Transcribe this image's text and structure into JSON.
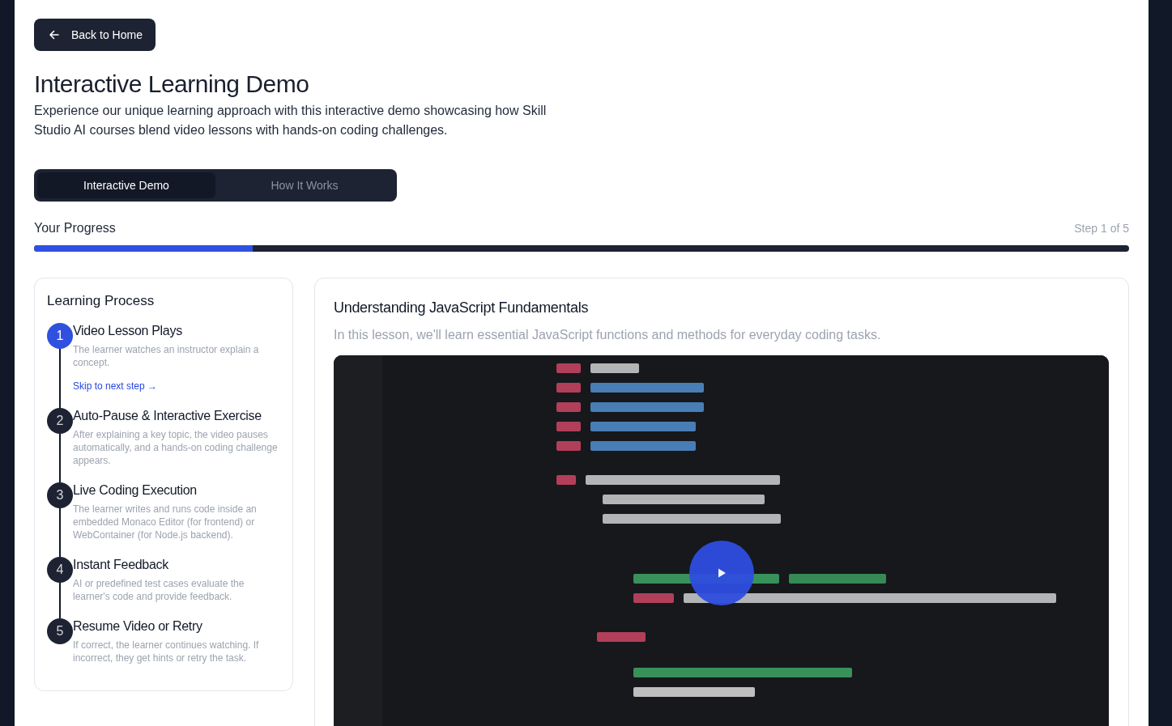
{
  "back_button": {
    "label": "Back to Home"
  },
  "title": "Interactive Learning Demo",
  "intro": "Experience our unique learning approach with this interactive demo showcasing how Skill Studio AI courses blend video lessons with hands-on coding challenges.",
  "tabs": [
    {
      "label": "Interactive Demo",
      "selected": true
    },
    {
      "label": "How It Works",
      "selected": false
    }
  ],
  "progress": {
    "label": "Your Progress",
    "step": "Step 1 of 5",
    "level": 0.2
  },
  "process": {
    "title": "Learning Process",
    "steps": [
      {
        "number": "1",
        "title": "Video Lesson Plays",
        "text": "The learner watches an instructor explain a concept.",
        "active": true,
        "link": "Skip to next step →"
      },
      {
        "number": "2",
        "title": "Auto-Pause & Interactive Exercise",
        "text": "After explaining a key topic, the video pauses automatically, and a hands-on coding challenge appears.",
        "active": false
      },
      {
        "number": "3",
        "title": "Live Coding Execution",
        "text": "The learner writes and runs code inside an embedded Monaco Editor (for frontend) or WebContainer (for Node.js backend).",
        "active": false
      },
      {
        "number": "4",
        "title": "Instant Feedback",
        "text": "AI or predefined test cases evaluate the learner's code and provide feedback.",
        "active": false
      },
      {
        "number": "5",
        "title": "Resume Video or Retry",
        "text": "If correct, the learner continues watching. If incorrect, they get hints or retry the task.",
        "active": false
      }
    ]
  },
  "lesson": {
    "title": "Understanding JavaScript Fundamentals",
    "description": "In this lesson, we'll learn essential JavaScript functions and methods for everyday coding tasks."
  }
}
